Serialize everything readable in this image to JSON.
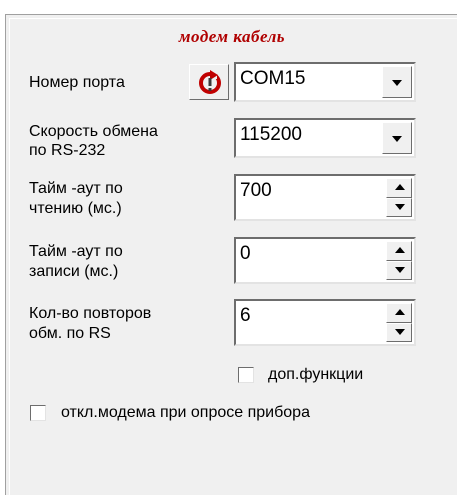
{
  "panel": {
    "title": "модем кабель"
  },
  "port": {
    "label": "Номер порта",
    "value": "COM15",
    "refresh_icon": "refresh-icon"
  },
  "speed": {
    "label_line1": "Скорость обмена",
    "label_line2": "по RS-232",
    "value": "115200"
  },
  "read_timeout": {
    "label_line1": "Тайм -аут по",
    "label_line2": "чтению (мс.)",
    "value": "700"
  },
  "write_timeout": {
    "label_line1": "Тайм -аут по",
    "label_line2": "записи (мс.)",
    "value": "0"
  },
  "retries": {
    "label_line1": "Кол-во повторов",
    "label_line2": "обм. по RS",
    "value": "6"
  },
  "extra_functions": {
    "label": "доп.функции",
    "checked": false
  },
  "modem_off": {
    "label": "откл.модема при опросе прибора",
    "checked": false
  },
  "colors": {
    "title": "#b00000",
    "refresh_icon": "#c00000",
    "panel_bg": "#f0f0f0"
  }
}
